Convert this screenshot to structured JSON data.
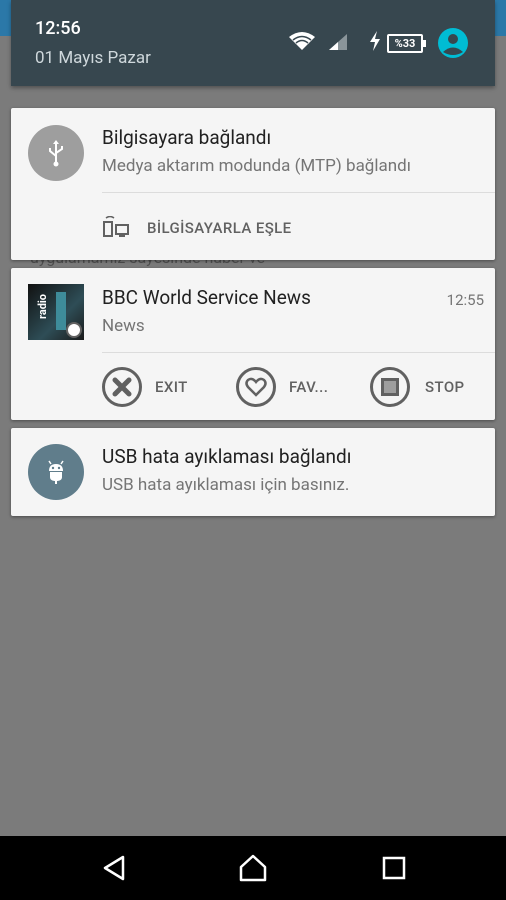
{
  "status": {
    "time": "12:56",
    "date": "01 Mayıs Pazar",
    "battery": "%33"
  },
  "background": {
    "partial_text": "uygulamamiz sayesinde haber ve"
  },
  "notifications": [
    {
      "title": "Bilgisayara bağlandı",
      "subtitle": "Medya aktarım modunda (MTP) bağlandı",
      "action": "BİLGİSAYARLA EŞLE"
    },
    {
      "title": "BBC World Service News",
      "subtitle": "News",
      "time": "12:55",
      "actions": [
        "EXIT",
        "FAV...",
        "STOP"
      ]
    },
    {
      "title": "USB hata ayıklaması bağlandı",
      "subtitle": "USB hata ayıklaması için basınız."
    }
  ],
  "icons": {
    "usb": "usb-icon",
    "android": "android-debug-icon",
    "radio": "radio-app-icon",
    "sync": "computer-sync-icon",
    "exit": "exit-icon",
    "fav": "heart-icon",
    "stop": "stop-icon",
    "back": "back-icon",
    "home": "home-icon",
    "recent": "recent-apps-icon"
  },
  "colors": {
    "header_bg": "#37474f",
    "card_bg": "#f5f5f5",
    "accent_avatar": "#00bcd4",
    "icon_circle": "#9e9e9e",
    "android_circle": "#607d8b"
  }
}
